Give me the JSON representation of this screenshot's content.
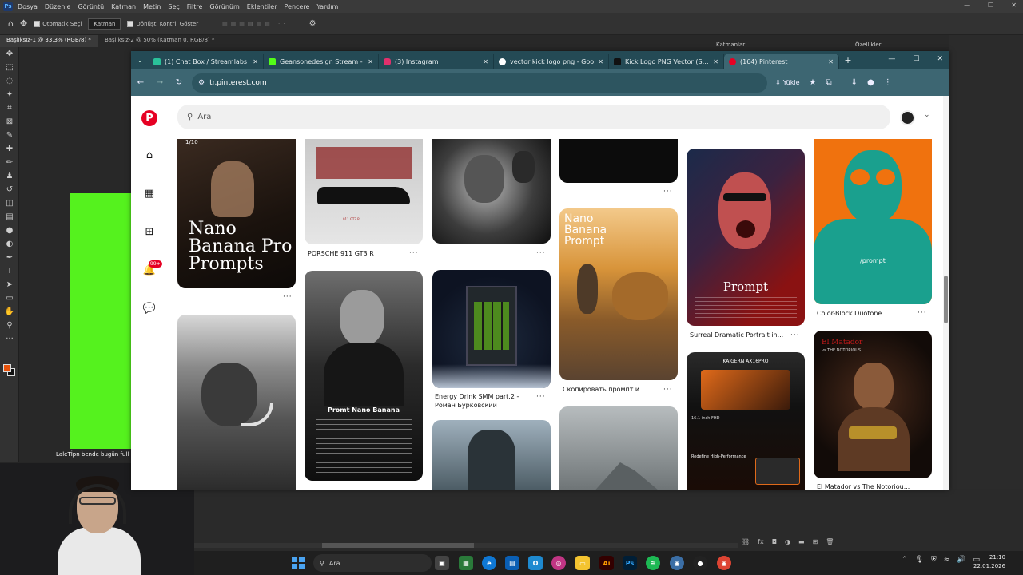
{
  "photoshop": {
    "menu": [
      "Dosya",
      "Düzenle",
      "Görüntü",
      "Katman",
      "Metin",
      "Seç",
      "Filtre",
      "Görünüm",
      "Eklentiler",
      "Pencere",
      "Yardım"
    ],
    "options": {
      "auto_select": "Otomatik Seçi",
      "layer_select": "Katman",
      "transform": "Dönüşt. Kontrl. Göster"
    },
    "doc_tabs": [
      "Başlıksız-1 @ 33,3% (RGB/8) *",
      "Başlıksız-2 @ 50% (Katman 0, RGB/8) *"
    ],
    "panel_layers": "Katmanlar",
    "panel_properties": "Özellikler",
    "canvas_caption": "LaleTİpn bende bugün full pinterest ve psd"
  },
  "browser": {
    "tabs": [
      {
        "title": "(1) Chat Box / Streamlabs",
        "favicon_color": "#2ac19a"
      },
      {
        "title": "Geansonedesign Stream - ",
        "favicon_color": "#53fc18"
      },
      {
        "title": "(3) Instagram",
        "favicon_color": "#e1306c"
      },
      {
        "title": "vector kick logo png - Goo",
        "favicon_color": "#ffffff"
      },
      {
        "title": "Kick Logo PNG Vector (SVG",
        "favicon_color": "#111111"
      },
      {
        "title": "(164) Pinterest",
        "favicon_color": "#e60023"
      }
    ],
    "url": "tr.pinterest.com",
    "install_label": "Yükle"
  },
  "pinterest": {
    "search_placeholder": "Ara",
    "notif_badge": "99+",
    "pin_counter": "1/10",
    "titles": {
      "porsche": "PORSCHE 911 GT3 R",
      "energy": "Energy Drink SMM part.2 -",
      "energy2": "Роман Бурковский",
      "lion": "Скопировать промпт и...",
      "surreal": "Surreal Dramatic Portrait in...",
      "colorblock": "Color-Block Duotone...",
      "matador": "El Matador vs The Notoriou..."
    },
    "overlays": {
      "nano1": "Nano",
      "nano2": "Banana Pro",
      "nano3": "Prompts",
      "lion1": "Nano",
      "lion2": "Banana",
      "lion3": "Prompt",
      "promt_nano": "Promt Nano Banana",
      "prompt_red": "Prompt",
      "prompt_slash": "/prompt",
      "kaigern": "KAIGERN AX16PRO",
      "redefine": "Redefine High-Performance",
      "fhd": "16.1-inch FHD",
      "matador_title": "El Matador",
      "matador_sub": "vs THE NOTORIOUS",
      "porsche_label": "911 GT3 R"
    }
  },
  "taskbar": {
    "search": "Ara",
    "time": "21:10",
    "date": "22.01.2026"
  }
}
